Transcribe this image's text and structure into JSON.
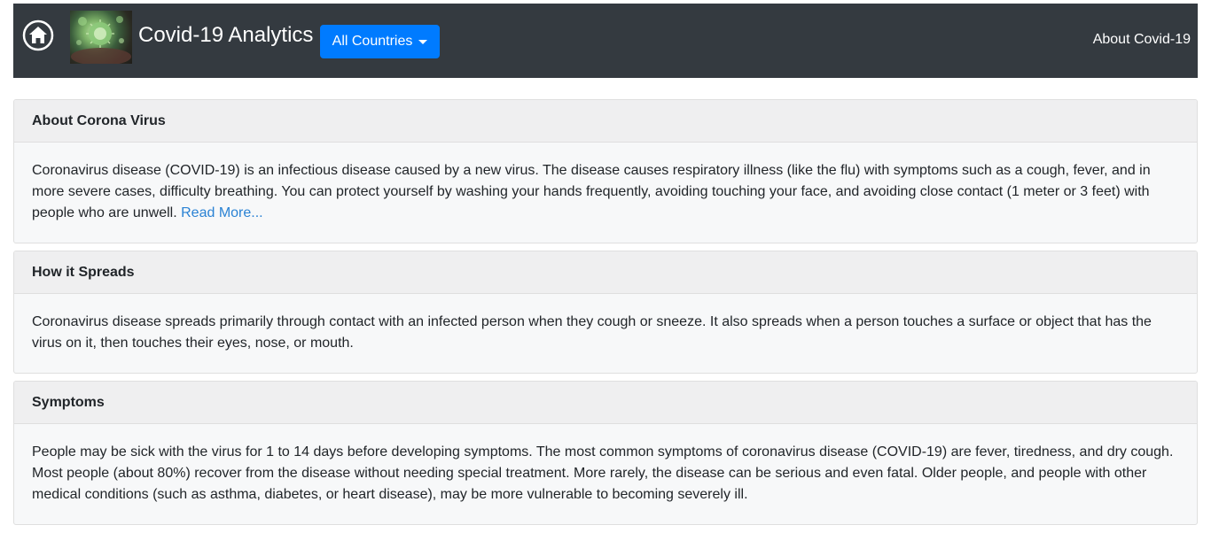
{
  "navbar": {
    "home_icon": "home-icon",
    "logo_icon": "virus-image",
    "brand": "Covid-19 Analytics",
    "dropdown_label": "All Countries",
    "about_link": "About Covid-19",
    "background_color": "#343a40",
    "dropdown_color": "#007bff"
  },
  "cards": [
    {
      "title": "About Corona Virus",
      "text": "Coronavirus disease (COVID-19) is an infectious disease caused by a new virus. The disease causes respiratory illness (like the flu) with symptoms such as a cough, fever, and in more severe cases, difficulty breathing. You can protect yourself by washing your hands frequently, avoiding touching your face, and avoiding close contact (1 meter or 3 feet) with people who are unwell.",
      "link": "Read More..."
    },
    {
      "title": "How it Spreads",
      "text": "Coronavirus disease spreads primarily through contact with an infected person when they cough or sneeze. It also spreads when a person touches a surface or object that has the virus on it, then touches their eyes, nose, or mouth."
    },
    {
      "title": "Symptoms",
      "text": "People may be sick with the virus for 1 to 14 days before developing symptoms. The most common symptoms of coronavirus disease (COVID-19) are fever, tiredness, and dry cough. Most people (about 80%) recover from the disease without needing special treatment. More rarely, the disease can be serious and even fatal. Older people, and people with other medical conditions (such as asthma, diabetes, or heart disease), may be more vulnerable to becoming severely ill."
    }
  ],
  "colors": {
    "link": "#2a82d4",
    "card_header_bg": "#efeff0",
    "card_body_bg": "#f7f8f9"
  }
}
